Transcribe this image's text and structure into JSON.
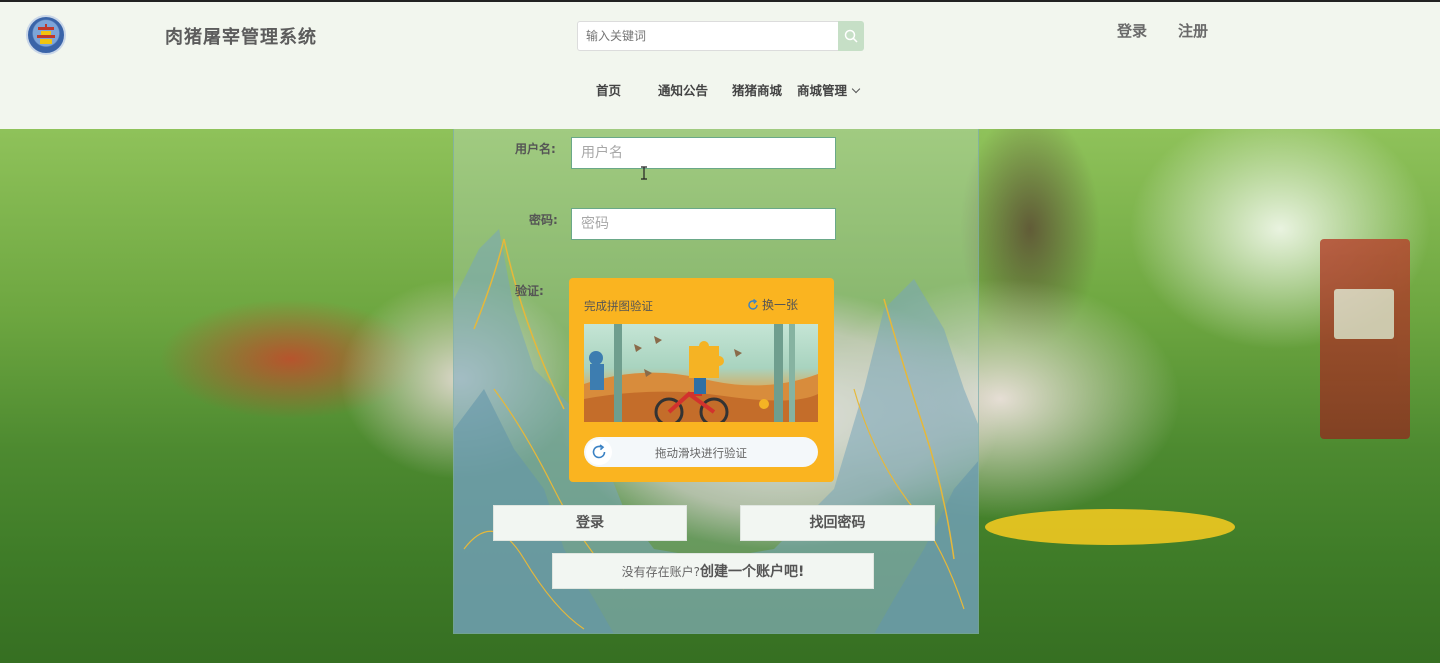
{
  "header": {
    "site_title": "肉猪屠宰管理系统",
    "search_placeholder": "输入关键词",
    "login_link": "登录",
    "register_link": "注册"
  },
  "nav": [
    {
      "label": "首页"
    },
    {
      "label": "通知公告"
    },
    {
      "label": "猪猪商城"
    },
    {
      "label": "商城管理"
    }
  ],
  "form": {
    "username_label": "用户名:",
    "username_placeholder": "用户名",
    "password_label": "密码:",
    "password_placeholder": "密码",
    "captcha_label": "验证:"
  },
  "captcha": {
    "title": "完成拼图验证",
    "refresh_label": "换一张",
    "slider_hint": "拖动滑块进行验证"
  },
  "actions": {
    "login_button": "登录",
    "recover_button": "找回密码",
    "no_account_text": "没有存在账户?",
    "create_account_text": "创建一个账户吧!"
  },
  "colors": {
    "header_bg": "#f2f6ee",
    "captcha_bg": "#fab420",
    "search_button": "#c6dfc6"
  }
}
